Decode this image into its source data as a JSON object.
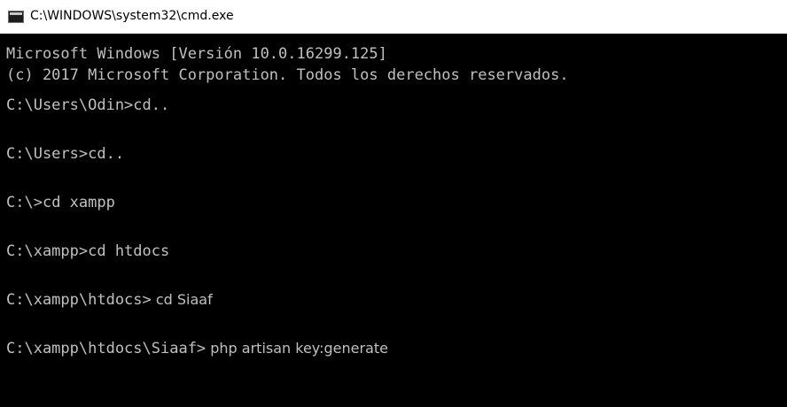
{
  "window": {
    "title": "C:\\WINDOWS\\system32\\cmd.exe",
    "icon": "cmd-app-icon"
  },
  "console": {
    "header": [
      "Microsoft Windows [Versión 10.0.16299.125]",
      "(c) 2017 Microsoft Corporation. Todos los derechos reservados."
    ],
    "entries": [
      {
        "prompt": "C:\\Users\\Odin>",
        "command": "cd.."
      },
      {
        "prompt": "C:\\Users>",
        "command": "cd.."
      },
      {
        "prompt": "C:\\>",
        "command": "cd xampp"
      },
      {
        "prompt": "C:\\xampp>",
        "command": "cd htdocs"
      },
      {
        "prompt": "C:\\xampp\\htdocs>",
        "command": " cd Siaaf"
      },
      {
        "prompt": "C:\\xampp\\htdocs\\Siaaf>",
        "command": " php artisan key:generate"
      }
    ]
  },
  "colors": {
    "console_background": "#000000",
    "console_text": "#c0c0c0",
    "titlebar_background": "#ffffff"
  }
}
